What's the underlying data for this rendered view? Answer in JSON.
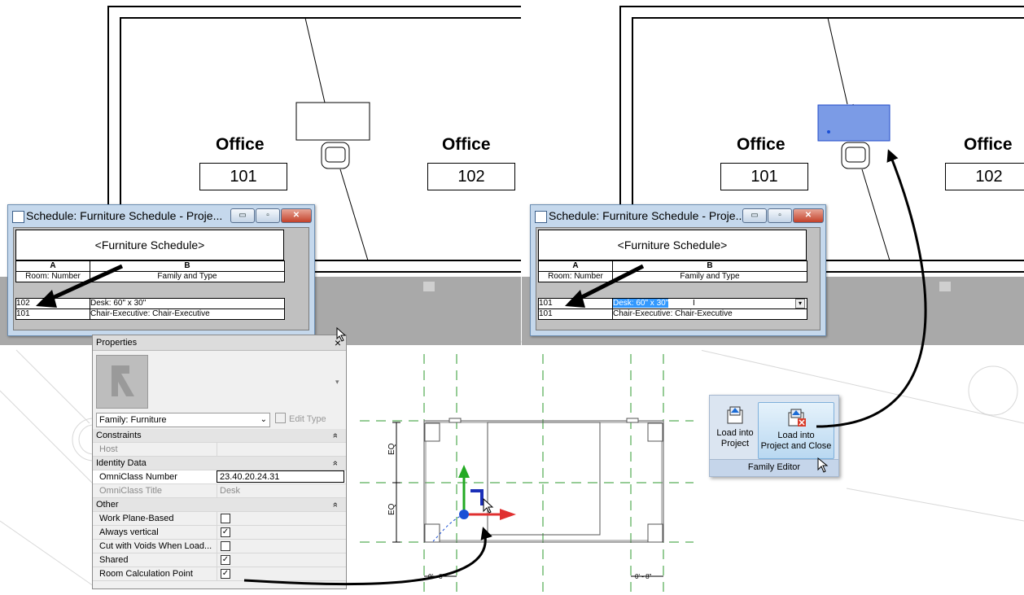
{
  "left_plan": {
    "office_a_label": "Office",
    "office_a_number": "101",
    "office_b_label": "Office",
    "office_b_number": "102"
  },
  "right_plan": {
    "office_a_label": "Office",
    "office_a_number": "101",
    "office_b_label": "Office",
    "office_b_number": "102"
  },
  "schedule_left": {
    "window_title": "Schedule: Furniture Schedule - Proje...",
    "title": "<Furniture Schedule>",
    "col_a_letter": "A",
    "col_b_letter": "B",
    "col_a_header": "Room: Number",
    "col_b_header": "Family and Type",
    "rows": [
      {
        "room": "102",
        "family": "Desk: 60\" x 30\""
      },
      {
        "room": "101",
        "family": "Chair-Executive: Chair-Executive"
      }
    ]
  },
  "schedule_right": {
    "window_title": "Schedule: Furniture Schedule - Proje...",
    "title": "<Furniture Schedule>",
    "col_a_letter": "A",
    "col_b_letter": "B",
    "col_a_header": "Room: Number",
    "col_b_header": "Family and Type",
    "rows": [
      {
        "room": "101",
        "family": "Desk: 60\" x 30\""
      },
      {
        "room": "101",
        "family": "Chair-Executive: Chair-Executive"
      }
    ]
  },
  "properties": {
    "title": "Properties",
    "close": "×",
    "family_select": "Family: Furniture",
    "edit_type": "Edit Type",
    "sections": {
      "constraints": "Constraints",
      "identity": "Identity Data",
      "other": "Other"
    },
    "collapse_glyph": "»",
    "host_label": "Host",
    "omniclass_number_label": "OmniClass Number",
    "omniclass_number_value": "23.40.20.24.31",
    "omniclass_title_label": "OmniClass Title",
    "omniclass_title_value": "Desk",
    "work_plane_label": "Work Plane-Based",
    "always_vertical_label": "Always vertical",
    "cut_voids_label": "Cut with Voids When Load...",
    "shared_label": "Shared",
    "room_calc_label": "Room Calculation Point",
    "checks": {
      "work_plane": false,
      "always_vertical": true,
      "cut_voids": false,
      "shared": true,
      "room_calc": true
    }
  },
  "family_drawing": {
    "eq_top": "EQ",
    "eq_bottom": "EQ",
    "dim_left": "0' - 8\"",
    "dim_right": "0' - 8\""
  },
  "ribbon": {
    "load_project": "Load into Project",
    "load_project_l1": "Load into",
    "load_project_l2": "Project",
    "load_close_l1": "Load into",
    "load_close_l2": "Project and Close",
    "panel_label": "Family Editor"
  },
  "colors": {
    "selection_blue": "#7b9be6",
    "arrow_green": "#22aa22",
    "arrow_red": "#e03030",
    "point_blue": "#1a4fd6",
    "ref_green": "#2c9a2c"
  }
}
